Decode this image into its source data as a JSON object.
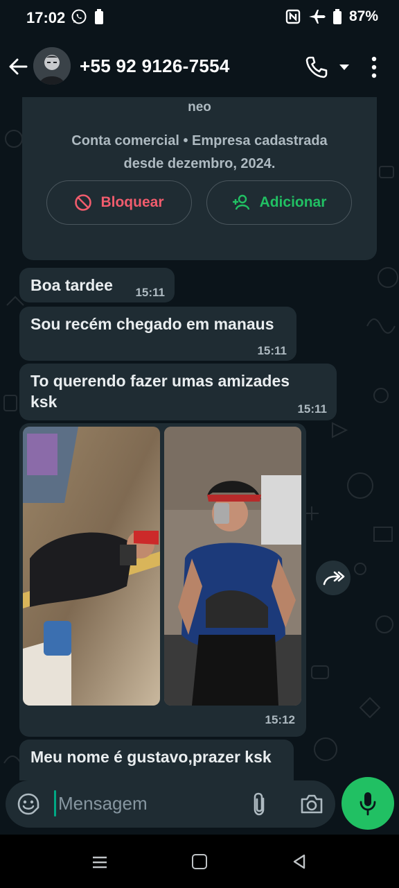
{
  "status_bar": {
    "time": "17:02",
    "battery_percent": "87%",
    "left_icons": [
      "whatsapp-icon",
      "battery-small-icon"
    ],
    "right_icons": [
      "nfc-icon",
      "airplane-icon",
      "battery-icon"
    ]
  },
  "header": {
    "contact_name": "+55 92 9126-7554",
    "icons": [
      "back-arrow-icon",
      "avatar",
      "phone-icon",
      "chevron-down-icon",
      "more-vertical-icon"
    ]
  },
  "business_card": {
    "name": "neo",
    "description": "Conta comercial • Empresa cadastrada desde dezembro, 2024.",
    "block_label": "Bloquear",
    "add_label": "Adicionar"
  },
  "messages": [
    {
      "text": "Boa tardee",
      "time": "15:11"
    },
    {
      "text": "Sou recém chegado em manaus",
      "time": "15:11"
    },
    {
      "text": "To querendo fazer umas amizades ksk",
      "time": "15:11"
    },
    {
      "type": "photos",
      "count": 2,
      "time": "15:12"
    },
    {
      "text": "Meu nome é gustavo,prazer ksk",
      "time": ""
    }
  ],
  "composer": {
    "placeholder": "Mensagem",
    "value": ""
  },
  "colors": {
    "background": "#0b141a",
    "bubble": "#1f2c33",
    "accent_green": "#21c063",
    "danger_red": "#f15c6d"
  }
}
